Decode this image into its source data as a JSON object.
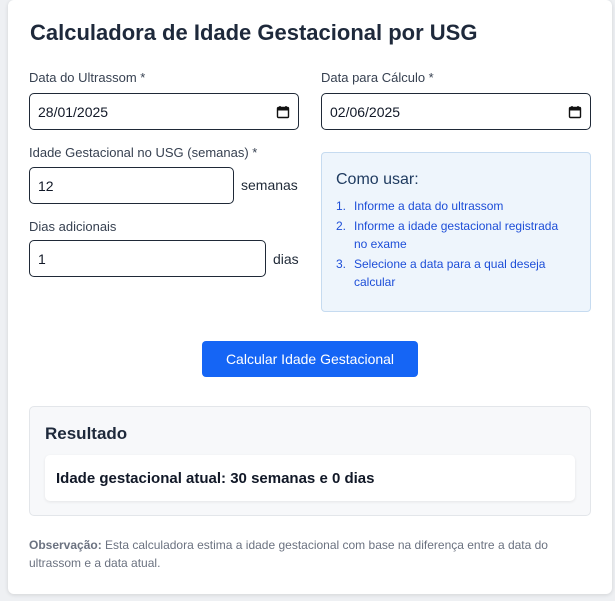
{
  "title": "Calculadora de Idade Gestacional por USG",
  "fields": {
    "ultrasound_date": {
      "label": "Data do Ultrassom *",
      "value": "28/01/2025"
    },
    "calc_date": {
      "label": "Data para Cálculo *",
      "value": "02/06/2025"
    },
    "ga_weeks": {
      "label": "Idade Gestacional no USG (semanas) *",
      "value": "12",
      "suffix": "semanas"
    },
    "extra_days": {
      "label": "Dias adicionais",
      "value": "1",
      "suffix": "dias"
    }
  },
  "howto": {
    "title": "Como usar:",
    "steps": [
      {
        "num": "1.",
        "text": "Informe a data do ultrassom"
      },
      {
        "num": "2.",
        "text": "Informe a idade gestacional registrada no exame"
      },
      {
        "num": "3.",
        "text": "Selecione a data para a qual deseja calcular"
      }
    ]
  },
  "calculate_button": "Calcular Idade Gestacional",
  "result": {
    "title": "Resultado",
    "text": "Idade gestacional atual: 30 semanas e 0 dias"
  },
  "note": {
    "label": "Observação:",
    "text": " Esta calculadora estima a idade gestacional com base na diferença entre a data do ultrassom e a data atual."
  },
  "icons": {
    "date_picker": "calendar-icon"
  },
  "colors": {
    "accent": "#1565f5",
    "info_bg": "#eef5fc",
    "info_text": "#1d4ed8"
  }
}
